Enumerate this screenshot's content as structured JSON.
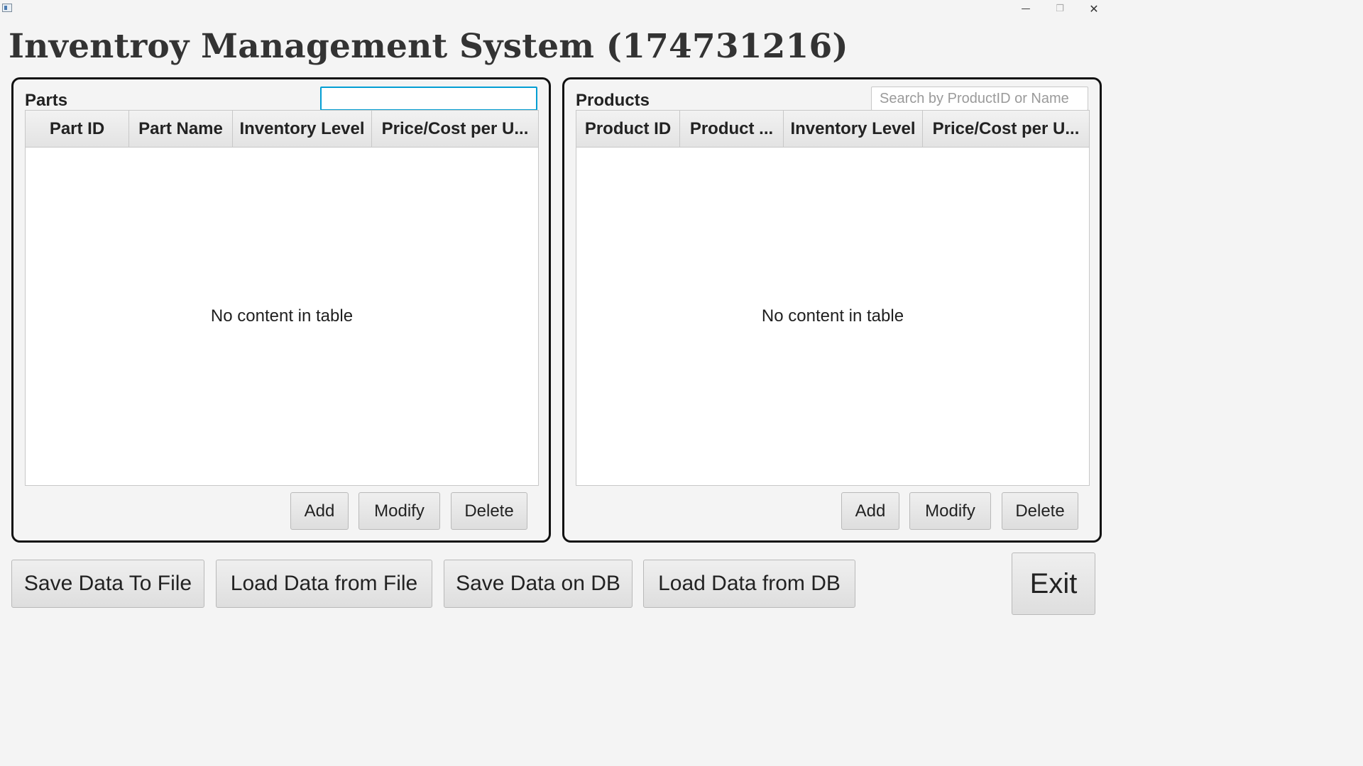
{
  "window": {
    "minimize_glyph": "—",
    "maximize_glyph": "❐",
    "close_glyph": "✕"
  },
  "app": {
    "title": "Inventroy Management System (174731216)"
  },
  "parts": {
    "label": "Parts",
    "search_value": "",
    "search_placeholder": "",
    "columns": [
      "Part ID",
      "Part Name",
      "Inventory Level",
      "Price/Cost per U..."
    ],
    "empty_text": "No content in table",
    "add_label": "Add",
    "modify_label": "Modify",
    "delete_label": "Delete"
  },
  "products": {
    "label": "Products",
    "search_value": "",
    "search_placeholder": "Search by ProductID or Name",
    "columns": [
      "Product ID",
      "Product ...",
      "Inventory Level",
      "Price/Cost per U..."
    ],
    "empty_text": "No content in table",
    "add_label": "Add",
    "modify_label": "Modify",
    "delete_label": "Delete"
  },
  "footer": {
    "save_file_label": "Save Data To File",
    "load_file_label": "Load Data from File",
    "save_db_label": "Save Data on DB",
    "load_db_label": "Load Data from DB",
    "exit_label": "Exit"
  },
  "colors": {
    "focus_accent": "#039ed3",
    "panel_border": "#111111",
    "background": "#f4f4f4"
  }
}
